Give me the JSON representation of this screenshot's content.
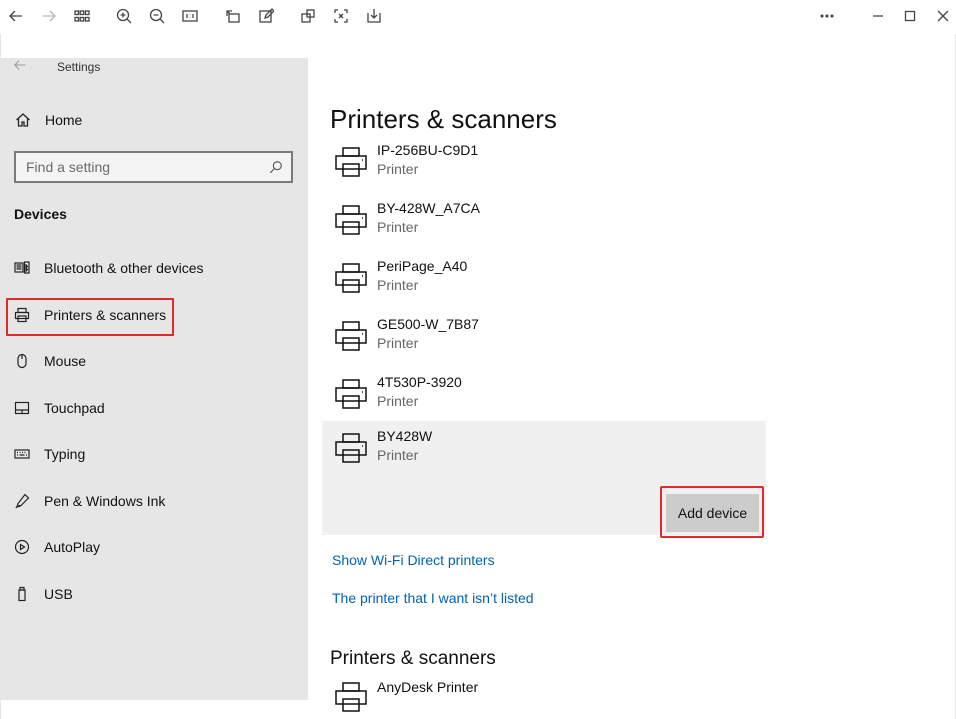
{
  "toolbar": {
    "buttons": [
      "back-icon",
      "forward-icon",
      "grid-view-icon",
      "zoom-in-icon",
      "zoom-out-icon",
      "actual-size-icon",
      "rotate-icon",
      "edit-icon",
      "crop-icon",
      "fit-icon",
      "save-icon"
    ],
    "window_controls": [
      "more-icon",
      "minimize-icon",
      "maximize-icon",
      "close-icon"
    ]
  },
  "settings": {
    "window_title": "Settings",
    "home_label": "Home",
    "search_placeholder": "Find a setting",
    "section_label": "Devices",
    "nav": [
      {
        "label": "Bluetooth & other devices",
        "icon": "bluetooth-devices-icon"
      },
      {
        "label": "Printers & scanners",
        "icon": "printer-icon",
        "selected": true
      },
      {
        "label": "Mouse",
        "icon": "mouse-icon"
      },
      {
        "label": "Touchpad",
        "icon": "touchpad-icon"
      },
      {
        "label": "Typing",
        "icon": "keyboard-icon"
      },
      {
        "label": "Pen & Windows Ink",
        "icon": "pen-icon"
      },
      {
        "label": "AutoPlay",
        "icon": "autoplay-icon"
      },
      {
        "label": "USB",
        "icon": "usb-icon"
      }
    ]
  },
  "main": {
    "title": "Printers & scanners",
    "devices": [
      {
        "name": "IP-256BU-C9D1",
        "type": "Printer"
      },
      {
        "name": "BY-428W_A7CA",
        "type": "Printer"
      },
      {
        "name": "PeriPage_A40",
        "type": "Printer"
      },
      {
        "name": "GE500-W_7B87",
        "type": "Printer"
      },
      {
        "name": "4T530P-3920",
        "type": "Printer"
      },
      {
        "name": "BY428W",
        "type": "Printer",
        "expanded": true
      }
    ],
    "add_device_label": "Add device",
    "link_wifi_direct": "Show Wi-Fi Direct printers",
    "link_not_listed": "The printer that I want isn’t listed",
    "subtitle": "Printers & scanners",
    "installed": [
      {
        "name": "AnyDesk Printer"
      }
    ]
  },
  "colors": {
    "accent_link": "#0063b1",
    "highlight_border": "#e02b2b",
    "sidebar_bg": "#e6e6e6"
  }
}
